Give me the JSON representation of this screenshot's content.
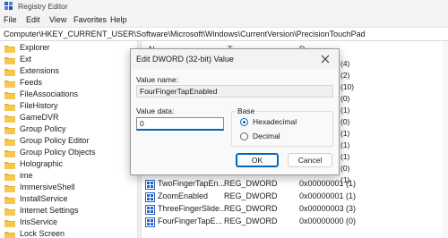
{
  "window": {
    "title": "Registry Editor"
  },
  "menu": [
    "File",
    "Edit",
    "View",
    "Favorites",
    "Help"
  ],
  "address": "Computer\\HKEY_CURRENT_USER\\Software\\Microsoft\\Windows\\CurrentVersion\\PrecisionTouchPad",
  "tree": {
    "items": [
      "Explorer",
      "Ext",
      "Extensions",
      "Feeds",
      "FileAssociations",
      "FileHistory",
      "GameDVR",
      "Group Policy",
      "Group Policy Editor",
      "Group Policy Objects",
      "Holographic",
      "ime",
      "ImmersiveShell",
      "InstallService",
      "Internet Settings",
      "IrisService",
      "Lock Screen"
    ]
  },
  "list": {
    "header_name": "N",
    "header_type": "T",
    "header_data": "D",
    "hidden_values": [
      "(4)",
      "(2)",
      "(10)",
      "(0)",
      "(1)",
      "(0)",
      "(1)",
      "(1)",
      "(1)",
      "(0)",
      "(1)"
    ],
    "rows": [
      {
        "name": "TwoFingerTapEn...",
        "type": "REG_DWORD",
        "data": "0x00000001 (1)"
      },
      {
        "name": "ZoomEnabled",
        "type": "REG_DWORD",
        "data": "0x00000001 (1)"
      },
      {
        "name": "ThreeFingerSlide...",
        "type": "REG_DWORD",
        "data": "0x00000003 (3)"
      },
      {
        "name": "FourFingerTapE...",
        "type": "REG_DWORD",
        "data": "0x00000000 (0)"
      }
    ]
  },
  "dialog": {
    "title": "Edit DWORD (32-bit) Value",
    "value_name_label": "Value name:",
    "value_name": "FourFingerTapEnabled",
    "value_data_label": "Value data:",
    "value_data": "0",
    "base_label": "Base",
    "radio_hex": "Hexadecimal",
    "radio_dec": "Decimal",
    "ok_label": "OK",
    "cancel_label": "Cancel"
  },
  "colors": {
    "accent": "#0067c0",
    "folder": "#e8b33a",
    "reg_icon": "#2b63c6"
  },
  "icons": {
    "app": "registry-editor-icon",
    "folder": "folder-icon",
    "value": "reg-dword-icon",
    "close": "close-icon"
  }
}
